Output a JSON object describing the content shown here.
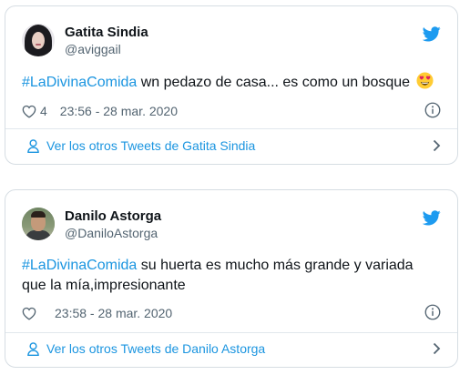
{
  "tweets": [
    {
      "name": "Gatita Sindia",
      "handle": "@aviggail",
      "hashtag": "#LaDivinaComida",
      "text": " wn pedazo de casa... es como un bosque ",
      "emoji": "heart-eyes-emoji",
      "likes": "4",
      "timestamp": "23:56 - 28 mar. 2020",
      "more_label": "Ver los otros Tweets de Gatita Sindia"
    },
    {
      "name": "Danilo Astorga",
      "handle": "@DaniloAstorga",
      "hashtag": "#LaDivinaComida",
      "text": " su huerta es mucho más grande y variada que la mía,impresionante",
      "likes": "",
      "timestamp": "23:58 - 28 mar. 2020",
      "more_label": "Ver los otros Tweets de Danilo Astorga"
    }
  ],
  "colors": {
    "accent": "#1b95e0",
    "text": "#0f1419",
    "secondary": "#536471",
    "border": "#d6dde3"
  }
}
